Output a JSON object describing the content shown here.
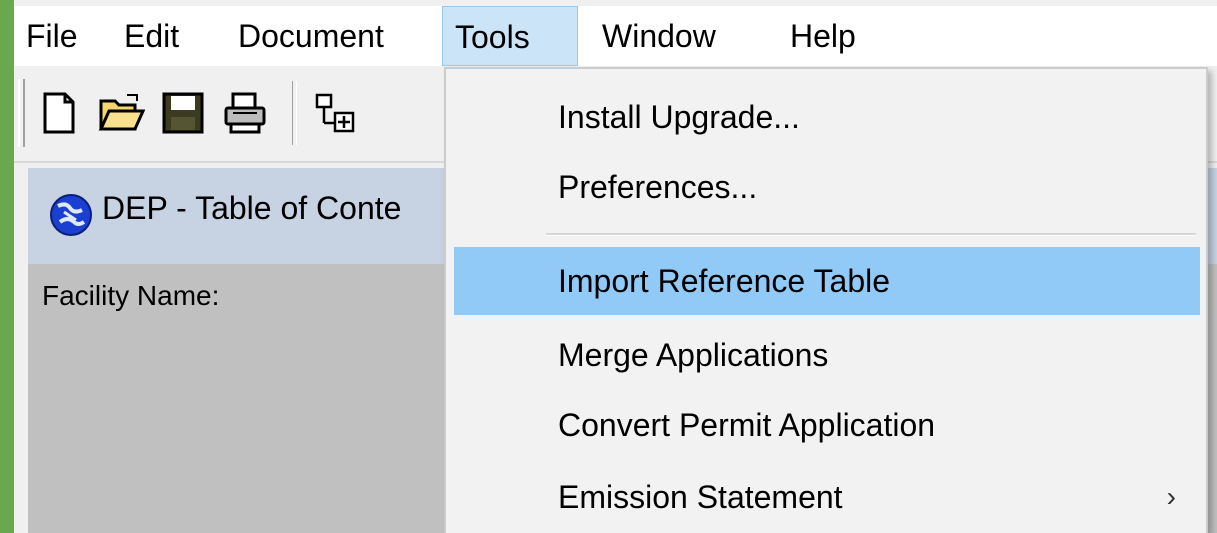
{
  "menubar": {
    "items": [
      "File",
      "Edit",
      "Document",
      "Tools",
      "Window",
      "Help"
    ],
    "open_menu": "Tools"
  },
  "toolbar": {
    "buttons": [
      "new-document-icon",
      "open-folder-icon",
      "save-disk-icon",
      "print-icon",
      "tree-add-icon"
    ]
  },
  "subwindow": {
    "title": "DEP - Table of Conte",
    "facility_label": "Facility Name:"
  },
  "tools_menu": {
    "items": [
      {
        "label": "Install Upgrade...",
        "highlighted": false
      },
      {
        "label": "Preferences...",
        "highlighted": false
      },
      {
        "label": "Import Reference Table",
        "highlighted": true
      },
      {
        "label": "Merge Applications",
        "highlighted": false
      },
      {
        "label": "Convert Permit Application",
        "highlighted": false
      },
      {
        "label": "Emission Statement",
        "highlighted": false,
        "submenu_arrow": "›"
      }
    ]
  },
  "colors": {
    "frame_green": "#6aa84f",
    "menu_open_bg": "#cce4f7",
    "item_highlight": "#91c9f7",
    "window_title_bg": "#c7d3e2",
    "window_body_bg": "#c0c0c0"
  }
}
